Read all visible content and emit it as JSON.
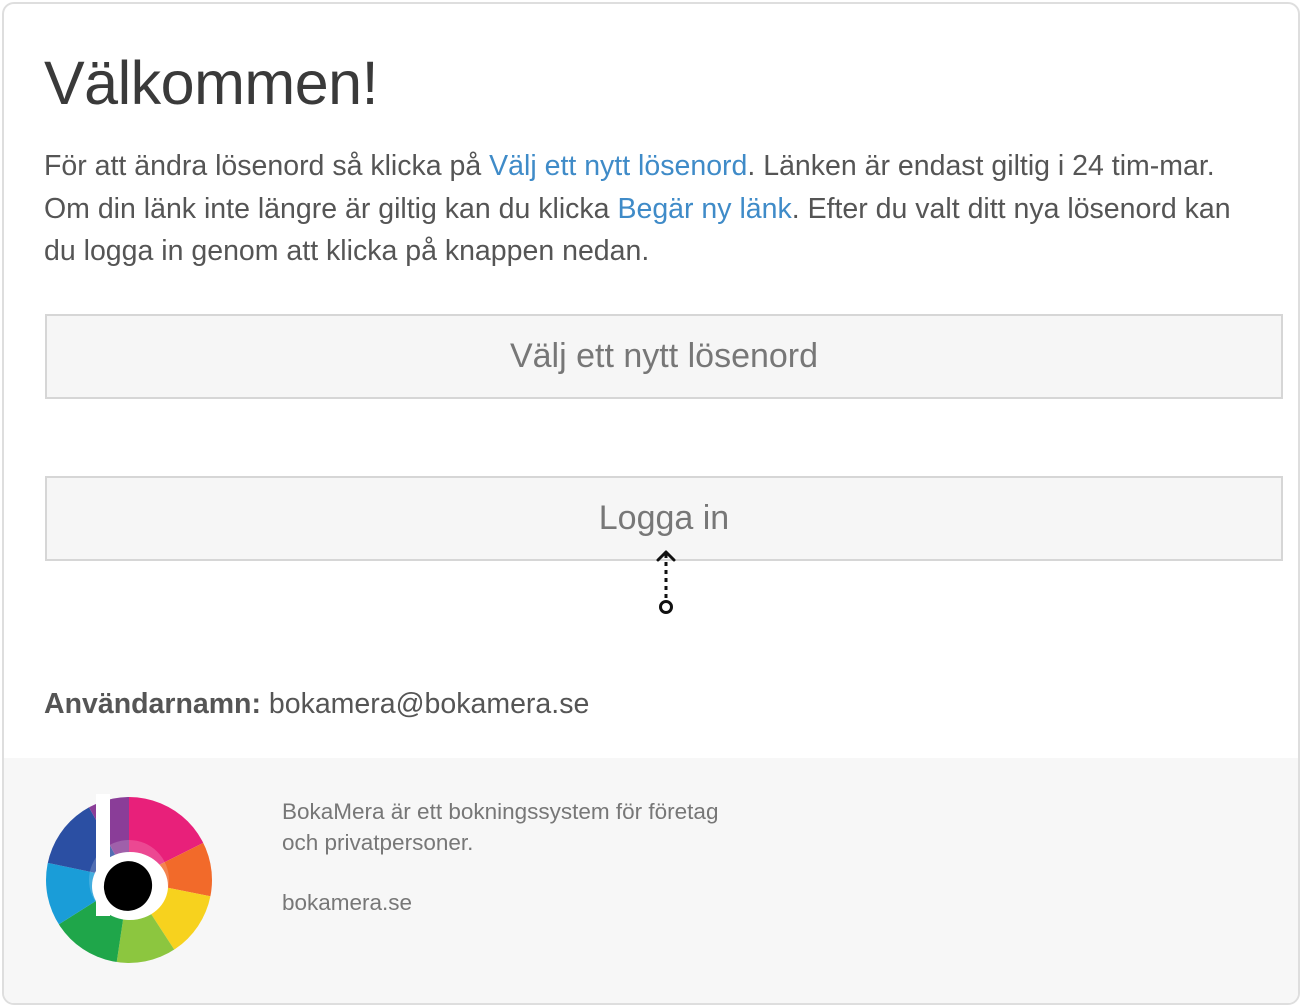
{
  "main": {
    "title": "Välkommen!",
    "intro": {
      "part1": "För att ändra lösenord så klicka på ",
      "link_new_password": "Välj ett nytt lösenord",
      "part2": ". Länken är endast giltig i 24 tim-mar. Om din länk inte längre är giltig kan du klicka ",
      "link_request_new": "Begär ny länk",
      "part3": ". Efter du valt ditt nya lösenord kan du logga in genom att klicka på knappen nedan."
    },
    "buttons": {
      "new_password": "Välj ett nytt lösenord",
      "login": "Logga in"
    },
    "username": {
      "label": "Användarnamn:",
      "value": "bokamera@bokamera.se"
    }
  },
  "footer": {
    "description_line1": "BokaMera är ett bokningssystem för företag",
    "description_line2": "och privatpersoner.",
    "website": "bokamera.se",
    "logo_icon": "bokamera-logo-icon"
  },
  "colors": {
    "link": "#3f8bc8",
    "text": "#555555",
    "button_bg": "#f6f6f6",
    "button_border": "#d6d6d6",
    "footer_bg": "#f7f7f7"
  }
}
